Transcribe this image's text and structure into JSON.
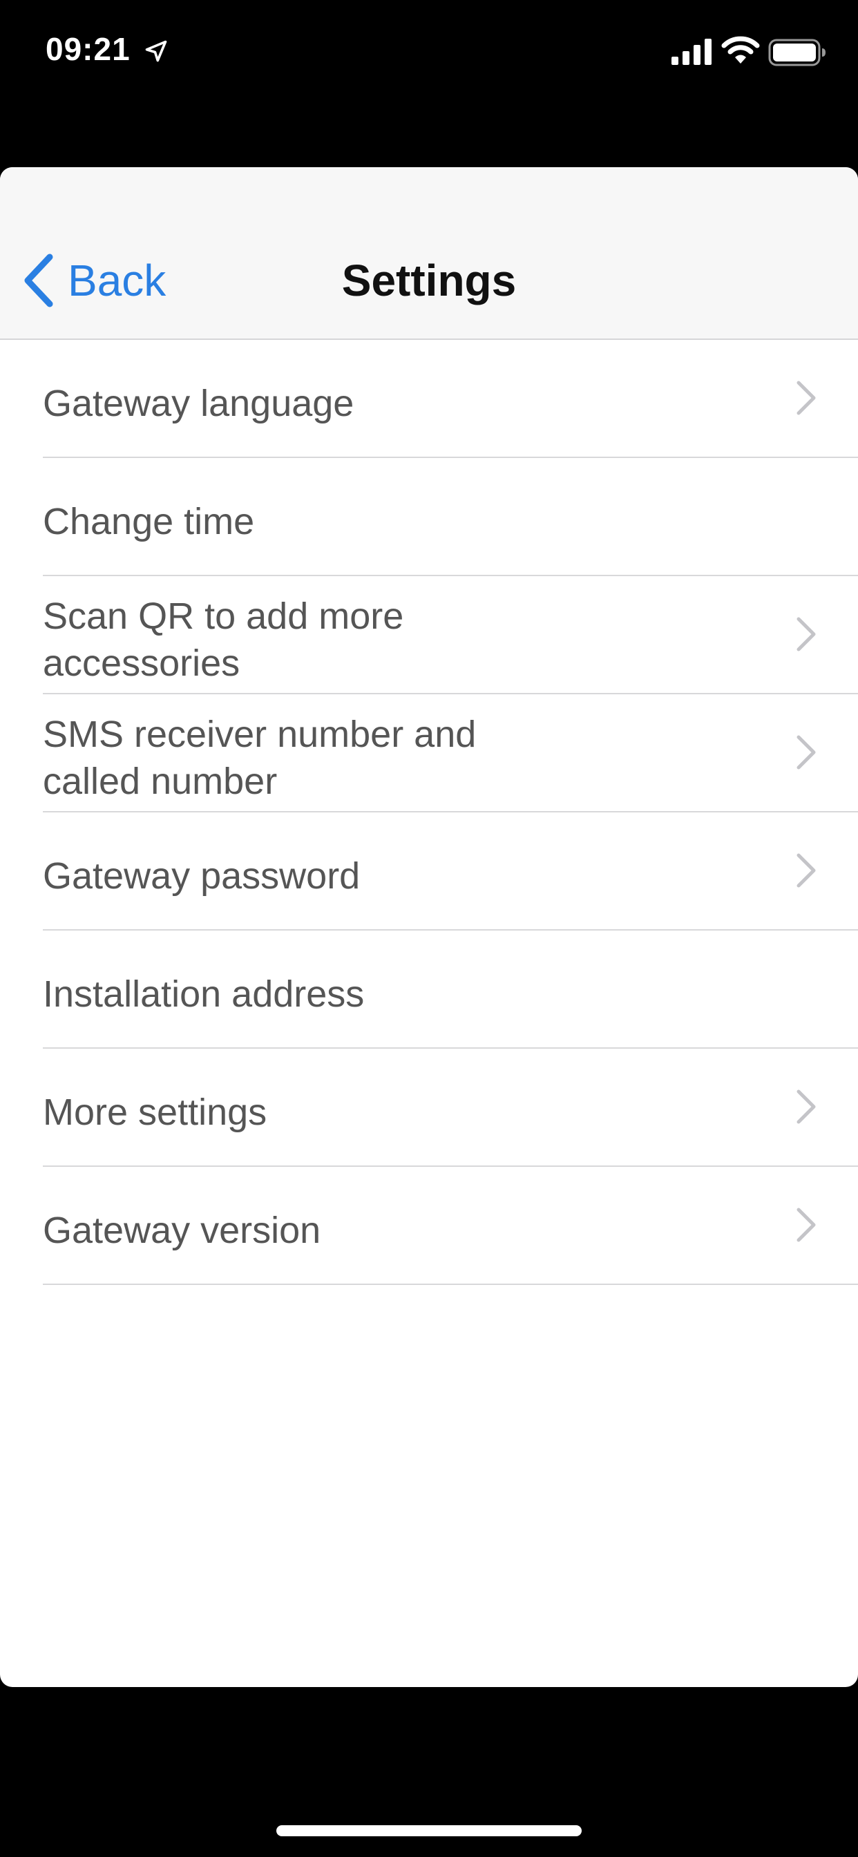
{
  "status_bar": {
    "time": "09:21",
    "icons": [
      "location-arrow-icon",
      "signal-icon",
      "wifi-icon",
      "battery-icon"
    ]
  },
  "nav": {
    "back_label": "Back",
    "title": "Settings"
  },
  "rows": [
    {
      "label": "Gateway language",
      "chevron": true
    },
    {
      "label": "Change time",
      "chevron": false
    },
    {
      "label": "Scan QR to add more accessories",
      "chevron": true
    },
    {
      "label": "SMS receiver number and called number",
      "chevron": true
    },
    {
      "label": "Gateway password",
      "chevron": true
    },
    {
      "label": "Installation address",
      "chevron": false
    },
    {
      "label": "More settings",
      "chevron": true
    },
    {
      "label": "Gateway version",
      "chevron": true
    }
  ],
  "colors": {
    "accent": "#2a7fe2",
    "row_text": "#555555",
    "separator": "#d8d8da",
    "nav_background": "#f7f7f7"
  }
}
